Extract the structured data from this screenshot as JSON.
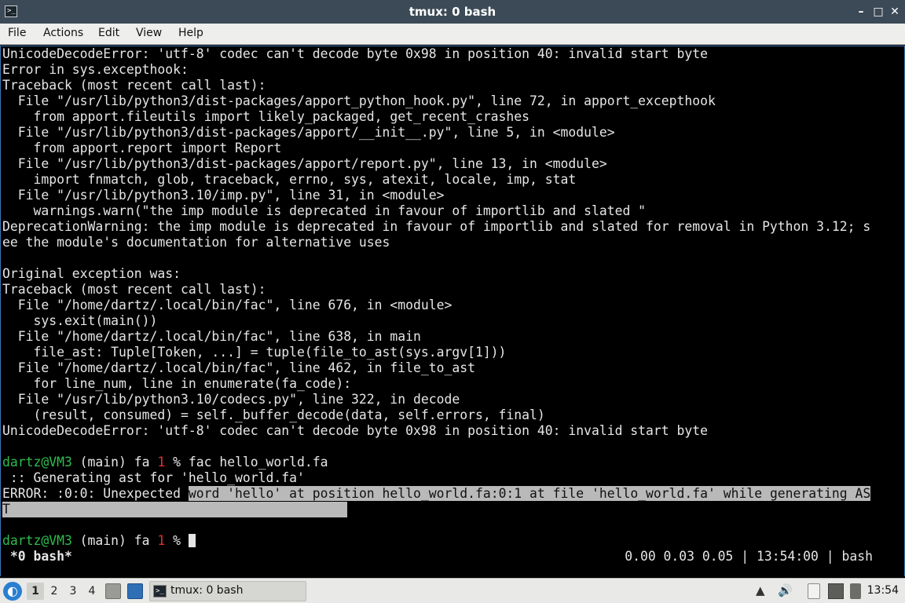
{
  "window": {
    "title": "tmux: 0 bash",
    "app_icon": ">_",
    "minimize_glyph": "–",
    "maximize_glyph": "□",
    "close_glyph": "✕"
  },
  "menubar": {
    "items": [
      "File",
      "Actions",
      "Edit",
      "View",
      "Help"
    ]
  },
  "terminal": {
    "lines": [
      "UnicodeDecodeError: 'utf-8' codec can't decode byte 0x98 in position 40: invalid start byte",
      "Error in sys.excepthook:",
      "Traceback (most recent call last):",
      "  File \"/usr/lib/python3/dist-packages/apport_python_hook.py\", line 72, in apport_excepthook",
      "    from apport.fileutils import likely_packaged, get_recent_crashes",
      "  File \"/usr/lib/python3/dist-packages/apport/__init__.py\", line 5, in <module>",
      "    from apport.report import Report",
      "  File \"/usr/lib/python3/dist-packages/apport/report.py\", line 13, in <module>",
      "    import fnmatch, glob, traceback, errno, sys, atexit, locale, imp, stat",
      "  File \"/usr/lib/python3.10/imp.py\", line 31, in <module>",
      "    warnings.warn(\"the imp module is deprecated in favour of importlib and slated \"",
      "DeprecationWarning: the imp module is deprecated in favour of importlib and slated for removal in Python 3.12; s",
      "ee the module's documentation for alternative uses",
      "",
      "Original exception was:",
      "Traceback (most recent call last):",
      "  File \"/home/dartz/.local/bin/fac\", line 676, in <module>",
      "    sys.exit(main())",
      "  File \"/home/dartz/.local/bin/fac\", line 638, in main",
      "    file_ast: Tuple[Token, ...] = tuple(file_to_ast(sys.argv[1]))",
      "  File \"/home/dartz/.local/bin/fac\", line 462, in file_to_ast",
      "    for line_num, line in enumerate(fa_code):",
      "  File \"/usr/lib/python3.10/codecs.py\", line 322, in decode",
      "    (result, consumed) = self._buffer_decode(data, self.errors, final)",
      "UnicodeDecodeError: 'utf-8' codec can't decode byte 0x98 in position 40: invalid start byte",
      ""
    ],
    "prompt1": {
      "user_host": "dartz@VM3",
      "context": " (main) fa ",
      "status": "1",
      "symbol": " % ",
      "command": "fac hello_world.fa"
    },
    "output_line": " :: Generating ast for 'hello_world.fa'",
    "error_prefix": "ERROR: :0:0: Unexpected ",
    "error_selected": "word 'hello' at position hello_world.fa:0:1 at file 'hello_world.fa' while generating AS",
    "error_wrap": "T",
    "prompt2": {
      "user_host": "dartz@VM3",
      "context": " (main) fa ",
      "status": "1",
      "symbol": " % "
    },
    "tmux_status": {
      "window": " *0 bash*",
      "right": "0.00 0.03 0.05 | 13:54:00 | bash"
    }
  },
  "taskbar": {
    "start_glyph": "◐",
    "workspaces": [
      "1",
      "2",
      "3",
      "4"
    ],
    "active_workspace": "1",
    "task_label": "tmux: 0 bash",
    "task_icon": ">_",
    "clock": "13:54",
    "tray_icons": [
      "eject-icon",
      "volume-icon",
      "clipboard-icon",
      "network-icon",
      "bluetooth-icon"
    ]
  },
  "colors": {
    "titlebar": "#3c4a57",
    "prompt_green": "#2dbd4e",
    "prompt_red": "#e2302a",
    "selection": "#b9b9b9"
  }
}
